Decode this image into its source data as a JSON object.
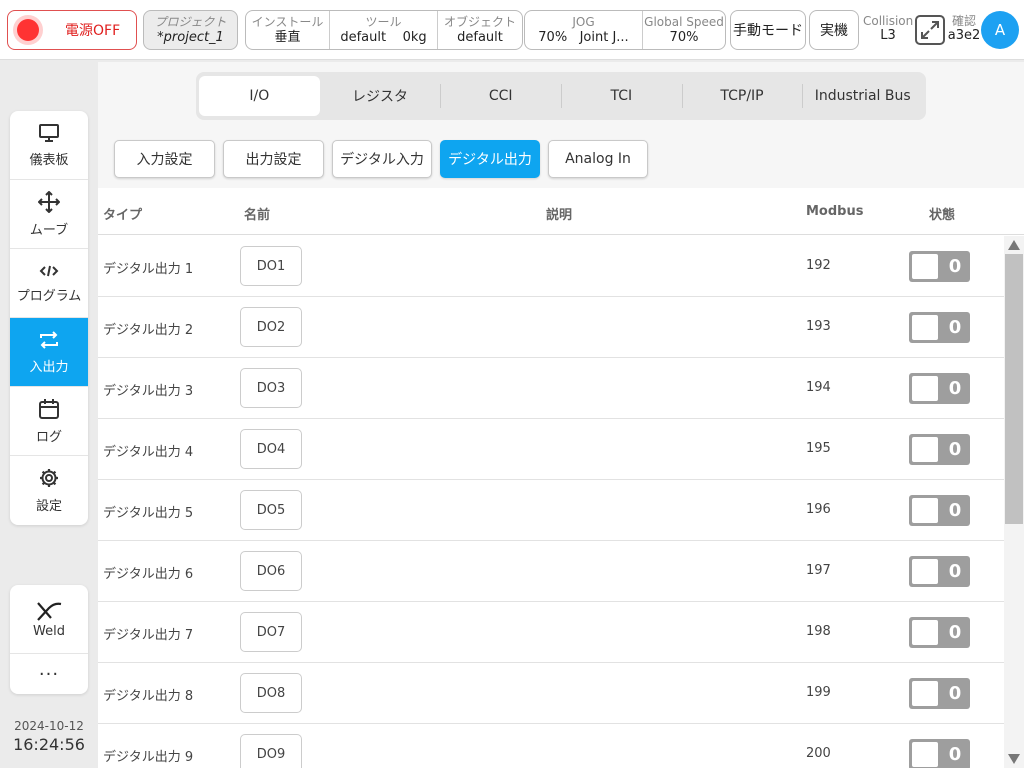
{
  "topbar": {
    "power_label": "電源OFF",
    "project": {
      "caption": "プロジェクト",
      "value": "*project_1"
    },
    "install": {
      "caption": "インストール",
      "value": "垂直"
    },
    "tool": {
      "caption": "ツール",
      "value_name": "default",
      "value_weight": "0kg"
    },
    "object": {
      "caption": "オブジェクト",
      "value": "default"
    },
    "jog": {
      "caption": "JOG",
      "value_percent": "70%",
      "value_mode": "Joint J..."
    },
    "global_speed": {
      "caption": "Global Speed",
      "value": "70%"
    },
    "manual_mode_label": "手動モード",
    "real_machine_label": "実機",
    "collision": {
      "caption": "Collision",
      "value": "L3"
    },
    "confirm": {
      "caption": "確認",
      "value": "a3e2"
    },
    "avatar_letter": "A"
  },
  "nav": {
    "items": [
      {
        "label": "儀表板",
        "icon": "monitor-icon"
      },
      {
        "label": "ムーブ",
        "icon": "move-icon"
      },
      {
        "label": "プログラム",
        "icon": "code-icon"
      },
      {
        "label": "入出力",
        "icon": "swap-icon",
        "active": true
      },
      {
        "label": "ログ",
        "icon": "calendar-icon"
      },
      {
        "label": "設定",
        "icon": "gear-icon"
      }
    ],
    "weld_label": "Weld",
    "more_label": "···"
  },
  "clock": {
    "date": "2024-10-12",
    "time": "16:24:56"
  },
  "tabs": [
    "I/O",
    "レジスタ",
    "CCI",
    "TCI",
    "TCP/IP",
    "Industrial Bus"
  ],
  "subtabs": [
    "入力設定",
    "出力設定",
    "デジタル入力",
    "デジタル出力",
    "Analog In"
  ],
  "table": {
    "headers": {
      "type": "タイプ",
      "name": "名前",
      "desc": "説明",
      "modbus": "Modbus",
      "state": "状態"
    },
    "rows": [
      {
        "type": "デジタル出力 1",
        "name": "DO1",
        "desc": "",
        "modbus": "192",
        "state": "0"
      },
      {
        "type": "デジタル出力 2",
        "name": "DO2",
        "desc": "",
        "modbus": "193",
        "state": "0"
      },
      {
        "type": "デジタル出力 3",
        "name": "DO3",
        "desc": "",
        "modbus": "194",
        "state": "0"
      },
      {
        "type": "デジタル出力 4",
        "name": "DO4",
        "desc": "",
        "modbus": "195",
        "state": "0"
      },
      {
        "type": "デジタル出力 5",
        "name": "DO5",
        "desc": "",
        "modbus": "196",
        "state": "0"
      },
      {
        "type": "デジタル出力 6",
        "name": "DO6",
        "desc": "",
        "modbus": "197",
        "state": "0"
      },
      {
        "type": "デジタル出力 7",
        "name": "DO7",
        "desc": "",
        "modbus": "198",
        "state": "0"
      },
      {
        "type": "デジタル出力 8",
        "name": "DO8",
        "desc": "",
        "modbus": "199",
        "state": "0"
      },
      {
        "type": "デジタル出力 9",
        "name": "DO9",
        "desc": "",
        "modbus": "200",
        "state": "0"
      }
    ]
  },
  "colors": {
    "accent": "#0ea5f0",
    "power_red": "#e0201f",
    "toggle_off": "#9e9e9e"
  }
}
